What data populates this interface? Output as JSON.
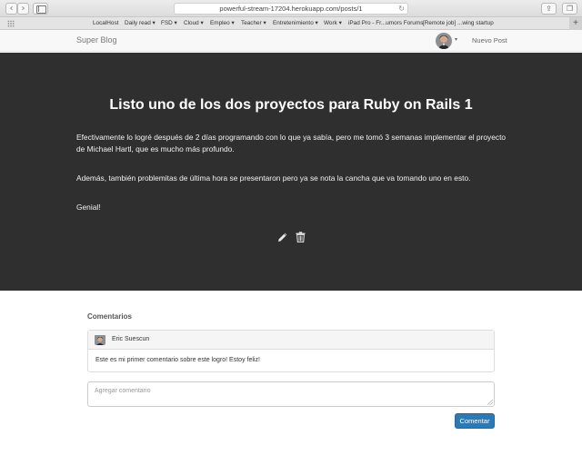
{
  "browser": {
    "url": "powerful-stream-17204.herokuapp.com/posts/1",
    "back_glyph": "‹",
    "forward_glyph": "›",
    "bookmarks": [
      "LocalHost",
      "Daily read ▾",
      "FSD ▾",
      "Cloud ▾",
      "Empleo ▾",
      "Teacher ▾",
      "Entretenimiento ▾",
      "Work ▾",
      "iPad Pro - Fr...umors Forums",
      "[Remote job] ...wing startup"
    ],
    "icons": [
      "back-icon",
      "forward-icon",
      "sidebar-icon",
      "reload-icon",
      "share-icon",
      "tabs-icon",
      "apps-grid-icon",
      "new-tab-plus-icon"
    ]
  },
  "navbar": {
    "brand": "Super Blog",
    "new_post": "Nuevo Post"
  },
  "post": {
    "title": "Listo uno de los dos proyectos para Ruby on Rails 1",
    "paragraphs": [
      "Efectivamente lo logré después de 2 días programando con lo que ya sabía, pero me tomó 3 semanas implementar el proyecto de Michael Hartl, que es mucho más profundo.",
      "Además, también problemitas de última hora se presentaron pero ya se nota la cancha que va tomando uno en esto.",
      "Genial!"
    ],
    "actions": [
      "edit-icon",
      "delete-icon"
    ]
  },
  "comments": {
    "heading": "Comentarios",
    "items": [
      {
        "author": "Eric Suescun",
        "body": "Este es mi primer comentario sobre este logro! Estoy feliz!"
      }
    ],
    "input_placeholder": "Agregar comentario",
    "submit_label": "Comentar"
  },
  "colors": {
    "hero_background": "#2f2f2f",
    "primary_button": "#2a7ab8"
  }
}
